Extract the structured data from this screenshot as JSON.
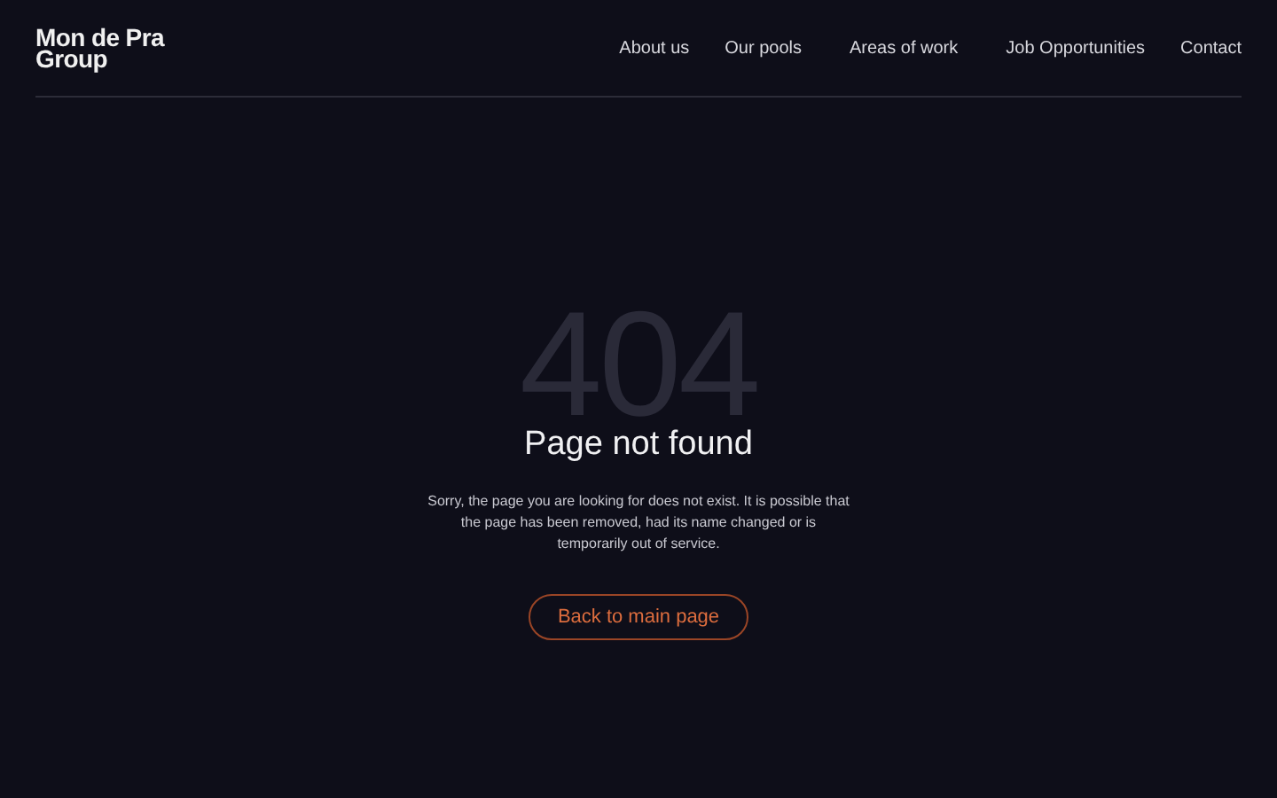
{
  "logo": "Mon de Pra Group",
  "nav": [
    "About us",
    "Our pools",
    "Areas of work",
    "Job Opportunities",
    "Contact"
  ],
  "error": {
    "code": "404",
    "title": "Page not found",
    "message": "Sorry, the page you are looking for does not exist. It is possible that the page has been removed, had its name changed or is temporarily out of service.",
    "button": "Back to main page"
  }
}
